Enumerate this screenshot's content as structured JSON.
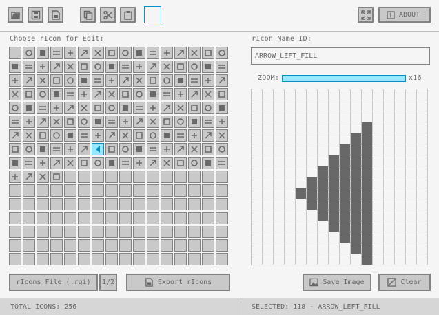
{
  "toolbar": {
    "about_label": "ABOUT",
    "tools": [
      {
        "name": "open-file",
        "icon": "folder-open-icon"
      },
      {
        "name": "save-file",
        "icon": "floppy-disk-icon"
      },
      {
        "name": "export-file",
        "icon": "export-icon"
      },
      {
        "name": "copy",
        "icon": "copy-icon"
      },
      {
        "name": "cut",
        "icon": "scissors-icon"
      },
      {
        "name": "paste",
        "icon": "clipboard-icon"
      }
    ],
    "color_swatch": "#f5f5f5"
  },
  "icon_panel": {
    "title": "Choose rIcon for Edit:",
    "selected_index": 118,
    "columns": 16,
    "rows": 16
  },
  "editor": {
    "name_label": "rIcon Name ID:",
    "name_value": "ARROW_LEFT_FILL",
    "zoom_label": "ZOOM:",
    "zoom_value": "x16",
    "zoom_fraction": 1.0,
    "pixels": [
      "................",
      "................",
      "................",
      "..........#.....",
      ".........##.....",
      "........###.....",
      ".......####.....",
      "......#####.....",
      ".....######.....",
      "....#######.....",
      ".....######.....",
      "......#####.....",
      ".......####.....",
      "........###.....",
      ".........##.....",
      "..........#....."
    ]
  },
  "buttons": {
    "file": "rIcons File (.rgi)",
    "page": "1/2",
    "export": "Export rIcons",
    "save_image": "Save Image",
    "clear": "Clear"
  },
  "status": {
    "total": "TOTAL ICONS: 256",
    "selected": "SELECTED: 118 - ARROW_LEFT_FILL"
  },
  "colors": {
    "base": "#c9c9c9",
    "border": "#838383",
    "text": "#686868",
    "selected_fill": "#97e8ff",
    "selected_border": "#0492c7",
    "pixel_on": "#686868"
  }
}
